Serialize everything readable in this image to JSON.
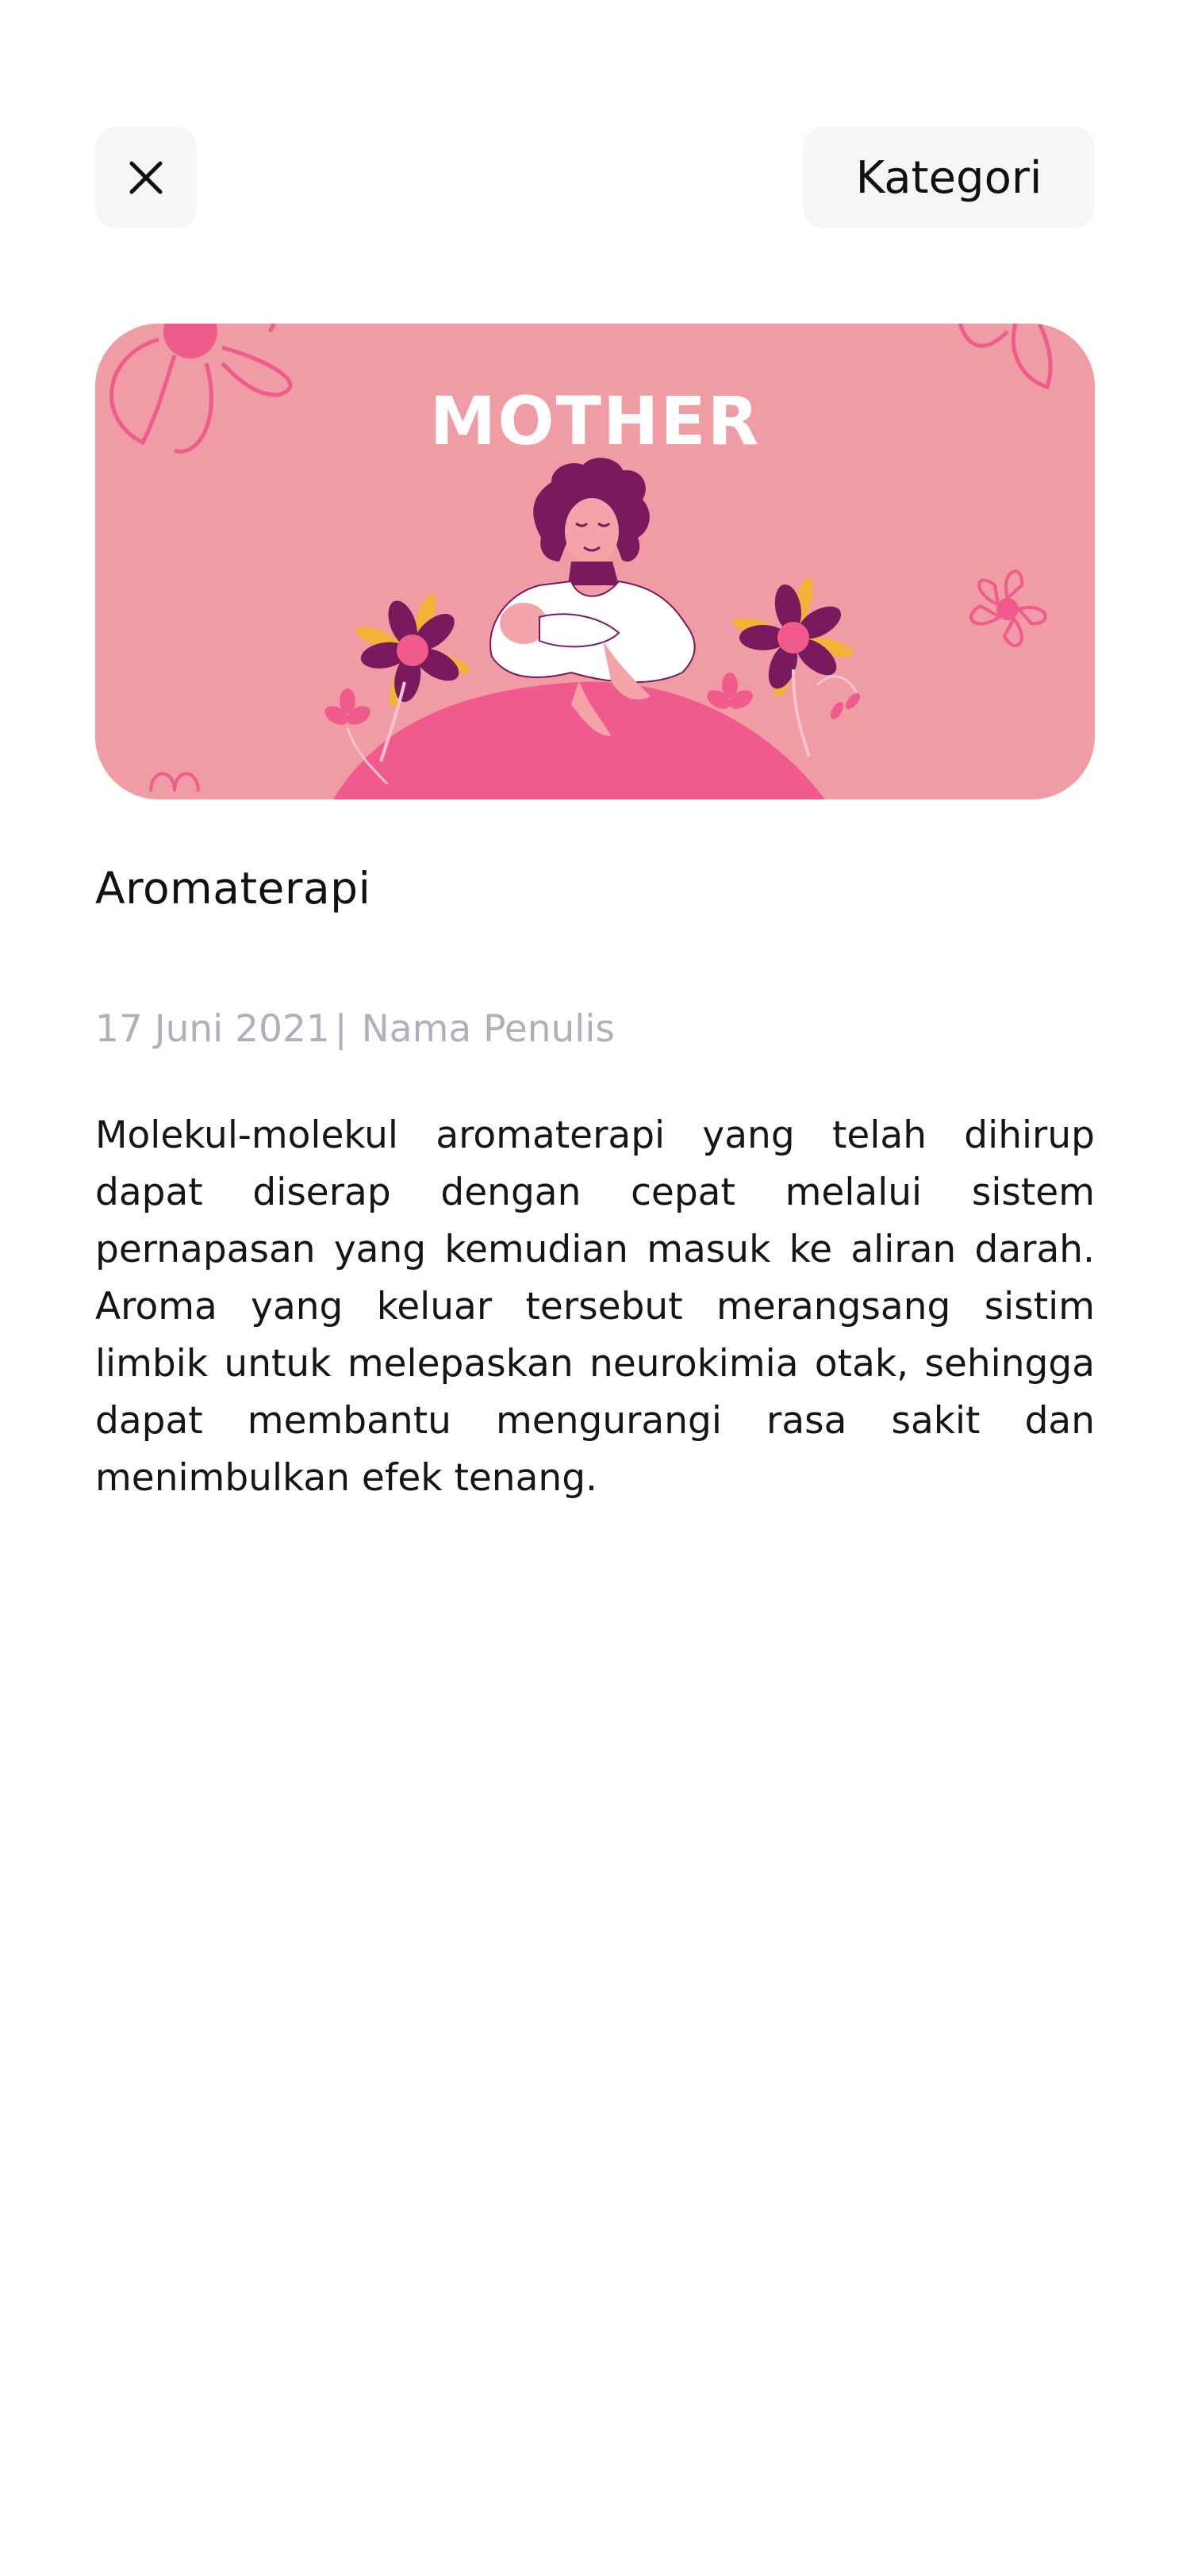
{
  "header": {
    "close_icon": "close-icon",
    "category_label": "Kategori"
  },
  "banner": {
    "title": "MOTHER",
    "background_color": "#ef9ca4",
    "accent_pink": "#f05a8c",
    "accent_purple": "#7a1a5e",
    "accent_yellow": "#f2b338"
  },
  "article": {
    "title": "Aromaterapi",
    "date": "17 Juni 2021",
    "separator": "|",
    "author": "Nama Penulis",
    "body": "Molekul-molekul aromaterapi yang telah dihirup dapat diserap dengan cepat melalui sistem pernapasan yang kemudian masuk ke aliran darah. Aroma yang keluar tersebut merangsang sistim limbik untuk melepaskan neurokimia otak, sehingga dapat membantu mengurangi rasa sakit dan menimbulkan efek tenang."
  }
}
